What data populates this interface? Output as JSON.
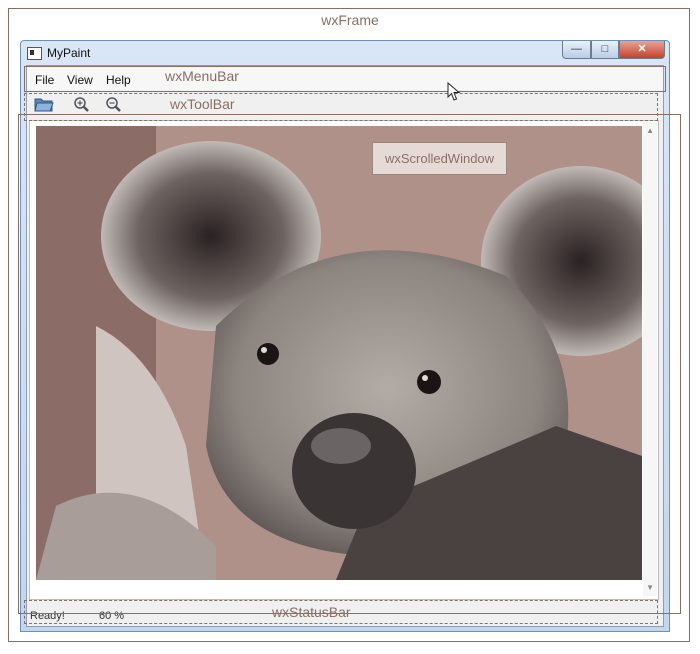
{
  "annotations": {
    "frame": "wxFrame",
    "menubar": "wxMenuBar",
    "toolbar": "wxToolBar",
    "scrolled_window": "wxScrolledWindow",
    "statusbar": "wxStatusBar"
  },
  "window": {
    "title": "MyPaint",
    "min_glyph": "—",
    "max_glyph": "□",
    "close_glyph": "✕"
  },
  "menu": {
    "items": [
      {
        "label": "File"
      },
      {
        "label": "View"
      },
      {
        "label": "Help"
      }
    ]
  },
  "toolbar": {
    "icons": [
      "open-folder-icon",
      "zoom-in-icon",
      "zoom-out-icon"
    ]
  },
  "content": {
    "image_subject": "koala-photo"
  },
  "status": {
    "text": "Ready!",
    "zoom": "60 %"
  },
  "colors": {
    "annotation": "#8a6e66",
    "titlebar": "#c2d6ef",
    "close_button": "#c64129"
  }
}
